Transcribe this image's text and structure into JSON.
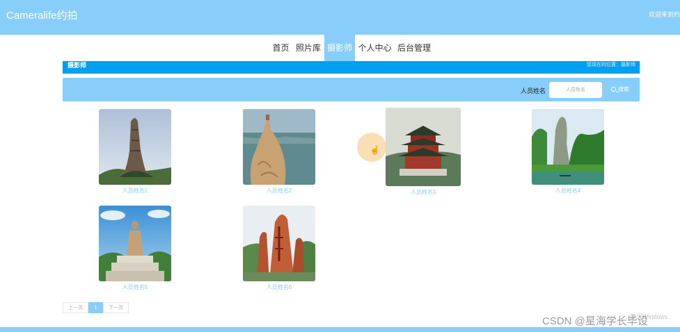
{
  "header": {
    "brand": "Cameralife约拍",
    "welcome": "欢迎来到约"
  },
  "nav": {
    "items": [
      "首页",
      "照片库",
      "摄影师",
      "个人中心",
      "后台管理"
    ],
    "active_index": 2
  },
  "breadcrumb": {
    "title": "摄影师",
    "location": "您现在的位置：摄影师"
  },
  "search": {
    "label": "人员姓名",
    "placeholder": "人员姓名",
    "button": "搜索"
  },
  "cards": [
    {
      "name": "人员姓名1",
      "image": "tall-rock-pillar"
    },
    {
      "name": "人员姓名2",
      "image": "coastal-cliff"
    },
    {
      "name": "人员姓名3",
      "image": "pavilion-tower"
    },
    {
      "name": "人员姓名4",
      "image": "river-karst-peaks"
    },
    {
      "name": "人员姓名5",
      "image": "buddha-statue"
    },
    {
      "name": "人员姓名6",
      "image": "red-carved-rock"
    }
  ],
  "pagination": {
    "prev": "上一页",
    "current": "1",
    "next": "下一页"
  },
  "watermark": {
    "csdn": "CSDN @星海学长毕设",
    "windows": "激活Windows"
  },
  "colors": {
    "accent": "#87cefa",
    "crumb": "#00a0f0"
  }
}
